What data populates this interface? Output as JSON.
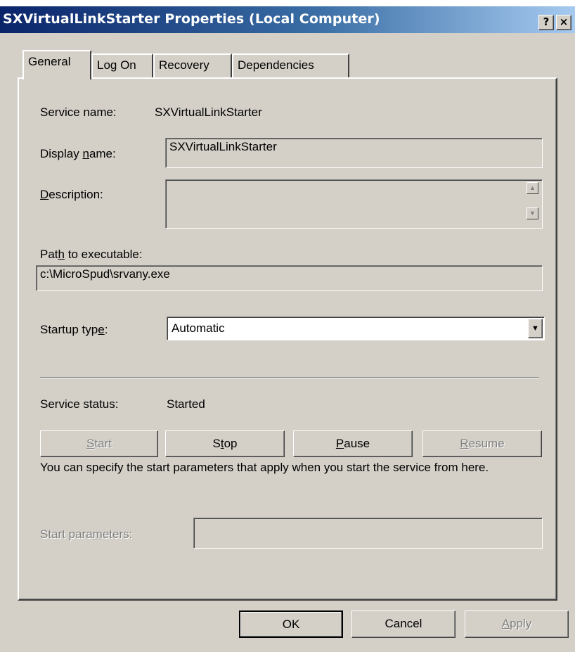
{
  "window": {
    "title": "SXVirtualLinkStarter Properties (Local Computer)",
    "help_button": "?",
    "close_button": "×"
  },
  "tabs": [
    {
      "label": "General",
      "active": true
    },
    {
      "label": "Log On"
    },
    {
      "label": "Recovery"
    },
    {
      "label": "Dependencies"
    }
  ],
  "general": {
    "service_name_label": "Service name:",
    "service_name_value": "SXVirtualLinkStarter",
    "display_name_label_pre": "Display ",
    "display_name_label_ul": "n",
    "display_name_label_post": "ame:",
    "display_name_value": "SXVirtualLinkStarter",
    "description_label_ul": "D",
    "description_label_post": "escription:",
    "description_value": "",
    "path_label_pre": "Pat",
    "path_label_ul": "h",
    "path_label_post": " to executable:",
    "path_value": "c:\\MicroSpud\\srvany.exe",
    "startup_label_pre": "Startup typ",
    "startup_label_ul": "e",
    "startup_label_post": ":",
    "startup_value": "Automatic",
    "status_label": "Service status:",
    "status_value": "Started",
    "buttons": {
      "start_ul": "S",
      "start_post": "tart",
      "stop_pre": "S",
      "stop_ul": "t",
      "stop_post": "op",
      "pause_ul": "P",
      "pause_post": "ause",
      "resume_ul": "R",
      "resume_post": "esume"
    },
    "info_text": "You can specify the start parameters that apply when you start the service from here.",
    "params_label_pre": "Start para",
    "params_label_ul": "m",
    "params_label_post": "eters:",
    "params_value": ""
  },
  "footer": {
    "ok": "OK",
    "cancel": "Cancel",
    "apply_ul": "A",
    "apply_post": "pply"
  },
  "colors": {
    "titlebar_start": "#0a246a",
    "titlebar_end": "#a6caf0",
    "face": "#d4d0c8"
  }
}
